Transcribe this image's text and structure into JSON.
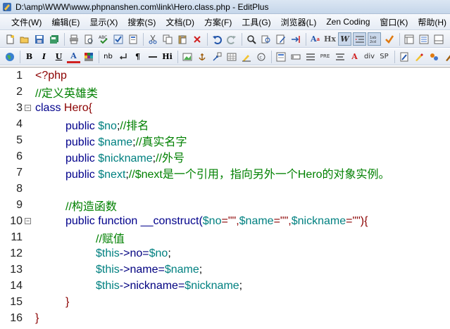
{
  "window": {
    "title": "D:\\amp\\WWW\\www.phpnanshen.com\\link\\Hero.class.php - EditPlus"
  },
  "menu": {
    "items": [
      "文件(W)",
      "编辑(E)",
      "显示(X)",
      "搜索(S)",
      "文档(D)",
      "方案(F)",
      "工具(G)",
      "浏览器(L)",
      "Zen Coding",
      "窗口(K)",
      "帮助(H)"
    ]
  },
  "toolbar2": {
    "nb": "nb",
    "hi": "Hi",
    "pre": "PRE",
    "div": "div",
    "sp": "SP",
    "ab": "A",
    "hx": "Hx"
  },
  "editor": {
    "lines": [
      {
        "num": "1",
        "fold": false
      },
      {
        "num": "2",
        "fold": false
      },
      {
        "num": "3",
        "fold": true
      },
      {
        "num": "4",
        "fold": false
      },
      {
        "num": "5",
        "fold": false
      },
      {
        "num": "6",
        "fold": false
      },
      {
        "num": "7",
        "fold": false
      },
      {
        "num": "8",
        "fold": false
      },
      {
        "num": "9",
        "fold": false
      },
      {
        "num": "10",
        "fold": true
      },
      {
        "num": "11",
        "fold": false
      },
      {
        "num": "12",
        "fold": false
      },
      {
        "num": "13",
        "fold": false
      },
      {
        "num": "14",
        "fold": false
      },
      {
        "num": "15",
        "fold": false
      },
      {
        "num": "16",
        "fold": false
      }
    ],
    "code": {
      "l1": "<?php",
      "l2": "//定义英雄类",
      "l3_kw": "class ",
      "l3_cls": "Hero{",
      "l4_kw": "public ",
      "l4_var": "$no",
      "l4_semi": ";",
      "l4_cm": "//排名",
      "l5_kw": "public ",
      "l5_var": "$name",
      "l5_semi": ";",
      "l5_cm": "//真实名字",
      "l6_kw": "public ",
      "l6_var": "$nickname",
      "l6_semi": ";",
      "l6_cm": "//外号",
      "l7_kw": "public ",
      "l7_var": "$next",
      "l7_semi": ";",
      "l7_cm": "//$next是一个引用，指向另外一个Hero的对象实例。",
      "l9_cm": "//构造函数",
      "l10_kw": "public function ",
      "l10_fn": "__construct(",
      "l10_v1": "$no",
      "l10_s1": "=\"\",",
      "l10_v2": "$name",
      "l10_s2": "=\"\",",
      "l10_v3": "$nickname",
      "l10_s3": "=\"\"){",
      "l11_cm": "//赋值",
      "l12_v1": "$this",
      "l12_op": "->no=",
      "l12_v2": "$no",
      "l12_end": ";",
      "l13_v1": "$this",
      "l13_op": "->name=",
      "l13_v2": "$name",
      "l13_end": ";",
      "l14_v1": "$this",
      "l14_op": "->nickname=",
      "l14_v2": "$nickname",
      "l14_end": ";",
      "l15": "}",
      "l16": "}"
    }
  },
  "colors": {
    "keyword": "#00008b",
    "variable": "#008080",
    "comment": "#008000",
    "php_tag": "#8b0000"
  }
}
